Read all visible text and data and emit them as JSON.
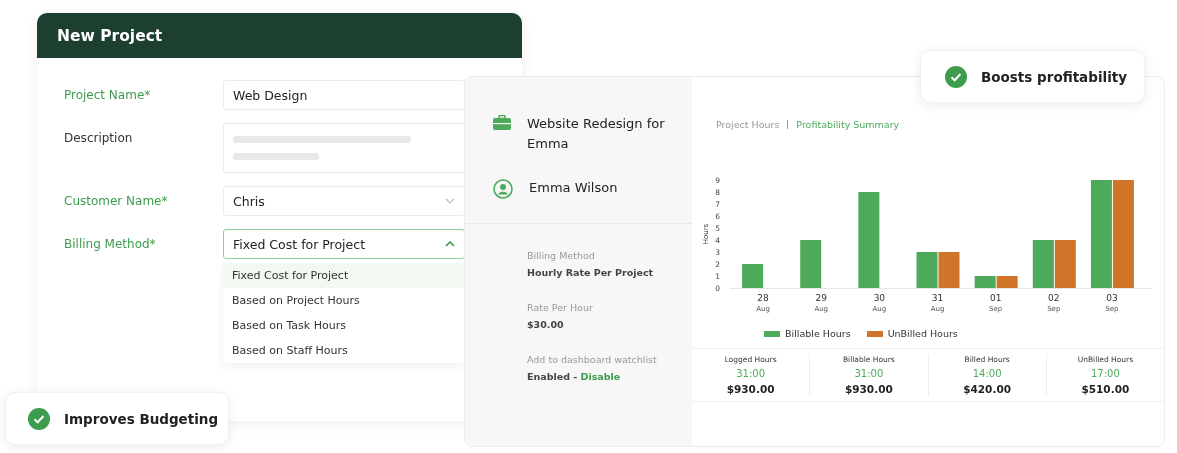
{
  "form": {
    "title": "New Project",
    "fields": [
      {
        "kind": "text",
        "label": "Project Name*",
        "required": true,
        "value": "Web Design"
      },
      {
        "kind": "textarea",
        "label": "Description",
        "required": false
      },
      {
        "kind": "select",
        "label": "Customer Name*",
        "required": true,
        "value": "Chris",
        "expanded": false
      },
      {
        "kind": "select",
        "label": "Billing Method*",
        "required": true,
        "value": "Fixed Cost for Project",
        "expanded": true,
        "options": [
          {
            "label": "Fixed Cost for Project",
            "selected": true
          },
          {
            "label": "Based on Project Hours",
            "selected": false
          },
          {
            "label": "Based on Task Hours",
            "selected": false
          },
          {
            "label": "Based on Staff Hours",
            "selected": false
          }
        ]
      }
    ]
  },
  "project": {
    "name": "Website Redesign for Emma",
    "customer": "Emma Wilson",
    "details": [
      {
        "label": "Billing Method",
        "value": "Hourly Rate Per Project"
      },
      {
        "label": "Rate Per Hour",
        "value": "$30.00"
      },
      {
        "label": "Add to dashboard watchlist",
        "value": "Enabled - ",
        "link": "Disable"
      }
    ]
  },
  "tabs": [
    {
      "label": "Project Hours",
      "selected": false
    },
    {
      "label": "Profitability Summary",
      "selected": true
    }
  ],
  "chart_data": {
    "type": "bar",
    "ylabel": "Hours",
    "categories": [
      "28 Aug",
      "29 Aug",
      "30 Aug",
      "31 Aug",
      "01 Sep",
      "02 Sep",
      "03 Sep"
    ],
    "series": [
      {
        "name": "Billable Hours",
        "color": "#4caa5a",
        "values": [
          2,
          4,
          8,
          3,
          1,
          4,
          9
        ]
      },
      {
        "name": "UnBilled Hours",
        "color": "#d0742a",
        "values": [
          null,
          null,
          null,
          3,
          1,
          4,
          9
        ]
      }
    ],
    "ylim": [
      0,
      9
    ],
    "legend": "bottom",
    "yticks": [
      0,
      1,
      2,
      3,
      4,
      5,
      6,
      7,
      8,
      9
    ]
  },
  "stats": [
    {
      "label": "Logged Hours",
      "hours": "31:00",
      "amount": "$930.00"
    },
    {
      "label": "Billable Hours",
      "hours": "31:00",
      "amount": "$930.00"
    },
    {
      "label": "Billed Hours",
      "hours": "14:00",
      "amount": "$420.00"
    },
    {
      "label": "UnBilled Hours",
      "hours": "17:00",
      "amount": "$510.00"
    }
  ],
  "badges": [
    {
      "label": "Boosts profitability"
    },
    {
      "label": "Improves Budgeting"
    }
  ]
}
